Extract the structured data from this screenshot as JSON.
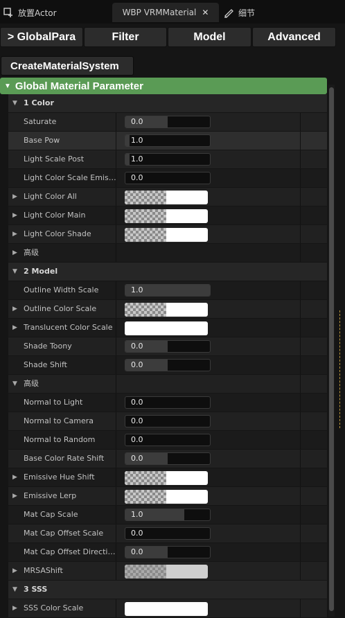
{
  "tabs": [
    {
      "label": "放置Actor",
      "icon": "place-actor-icon"
    },
    {
      "label": "WBP VRMMaterial",
      "close": "✕"
    },
    {
      "label": "细节",
      "icon": "details-brush-icon"
    }
  ],
  "buttons": [
    "> GlobalPara",
    "Filter",
    "Model",
    "Advanced"
  ],
  "create_button": "CreateMaterialSystem",
  "category_title": "Global Material Parameter",
  "rows": [
    {
      "type": "section",
      "label": "1 Color"
    },
    {
      "type": "num",
      "label": "Saturate",
      "value": "0.0",
      "fill": 0.5
    },
    {
      "type": "num",
      "label": "Base Pow",
      "value": "1.0",
      "fill": 0.05,
      "hl": true
    },
    {
      "type": "num",
      "label": "Light Scale Post",
      "value": "1.0",
      "fill": 0.05
    },
    {
      "type": "num",
      "label": "Light Color Scale Emissi...",
      "value": "0.0",
      "fill": 0
    },
    {
      "type": "color",
      "label": "Light Color All"
    },
    {
      "type": "color",
      "label": "Light Color Main"
    },
    {
      "type": "color",
      "label": "Light Color Shade"
    },
    {
      "type": "sub",
      "label": "高级"
    },
    {
      "type": "section",
      "label": "2 Model"
    },
    {
      "type": "num",
      "label": "Outline Width Scale",
      "value": "1.0",
      "fill": 1.0
    },
    {
      "type": "color",
      "label": "Outline Color Scale"
    },
    {
      "type": "color",
      "label": "Translucent Color Scale",
      "solid": true
    },
    {
      "type": "num",
      "label": "Shade Toony",
      "value": "0.0",
      "fill": 0.5
    },
    {
      "type": "num",
      "label": "Shade Shift",
      "value": "0.0",
      "fill": 0.5
    },
    {
      "type": "subopen",
      "label": "高级"
    },
    {
      "type": "num",
      "label": "Normal to Light",
      "value": "0.0",
      "fill": 0
    },
    {
      "type": "num",
      "label": "Normal to Camera",
      "value": "0.0",
      "fill": 0
    },
    {
      "type": "num",
      "label": "Normal to Random",
      "value": "0.0",
      "fill": 0
    },
    {
      "type": "num",
      "label": "Base Color Rate Shift",
      "value": "0.0",
      "fill": 0.5
    },
    {
      "type": "color",
      "label": "Emissive Hue Shift"
    },
    {
      "type": "color",
      "label": "Emissive Lerp"
    },
    {
      "type": "num",
      "label": "Mat Cap Scale",
      "value": "1.0",
      "fill": 0.7
    },
    {
      "type": "num",
      "label": "Mat Cap Offset Scale",
      "value": "0.0",
      "fill": 0
    },
    {
      "type": "num",
      "label": "Mat Cap Offset Direction",
      "value": "0.0",
      "fill": 0.5
    },
    {
      "type": "color",
      "label": "MRSAShift",
      "dim": true
    },
    {
      "type": "section",
      "label": "3 SSS"
    },
    {
      "type": "color",
      "label": "SSS Color Scale",
      "solid": true
    }
  ]
}
